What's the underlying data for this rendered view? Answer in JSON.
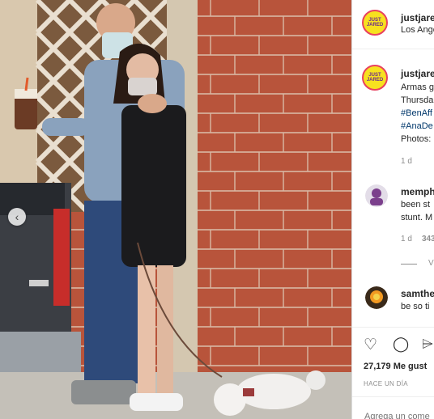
{
  "header": {
    "username": "justjared",
    "location": "Los Angeles",
    "avatar_text": "JUST JARED"
  },
  "caption": {
    "username": "justjared",
    "lines": [
      "Armas g",
      "Thursda",
      "#BenAff",
      "#AnaDe",
      "Photos:"
    ],
    "time": "1 d"
  },
  "comments": [
    {
      "username": "memphi",
      "lines": [
        "been st",
        "stunt. M"
      ],
      "time": "1 d",
      "likes": "343"
    },
    {
      "username": "samthe",
      "lines": [
        "be so ti"
      ]
    }
  ],
  "actions": {
    "like": "♡",
    "comment": "◯",
    "share": "⌲"
  },
  "likes_text": "27,179 Me gust",
  "posted_ago": "HACE UN DÍA",
  "add_comment_placeholder": "Agrega un come",
  "carousel": {
    "prev": "‹"
  },
  "colors": {
    "brand_yellow": "#f7e11f",
    "brand_ring": "#e8415f",
    "hashtag": "#00376b"
  }
}
